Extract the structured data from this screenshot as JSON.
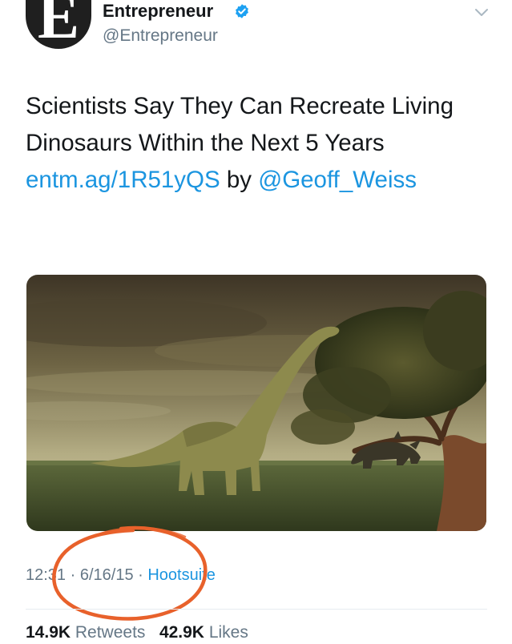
{
  "author": {
    "avatar_letter": "E",
    "display_name": "Entrepreneur",
    "handle": "@Entrepreneur",
    "verified": true
  },
  "icons": {
    "verified": "verified-badge-icon",
    "menu": "chevron-down-icon"
  },
  "tweet": {
    "text_1": "Scientists Say They Can Recreate Living Dinosaurs Within the Next 5 Years ",
    "link": "entm.ag/1R51yQS",
    "text_2": " by ",
    "mention": "@Geoff_Weiss"
  },
  "meta": {
    "time": "12:31",
    "sep1": " · ",
    "date": "6/16/15",
    "sep2": " · ",
    "source": "Hootsuite"
  },
  "stats": {
    "retweets_count": "14.9K",
    "retweets_label": " Retweets",
    "likes_count": "42.9K",
    "likes_label": " Likes"
  },
  "colors": {
    "link": "#1b95e0",
    "secondary_text": "#657786",
    "annotation": "#e8612b"
  }
}
